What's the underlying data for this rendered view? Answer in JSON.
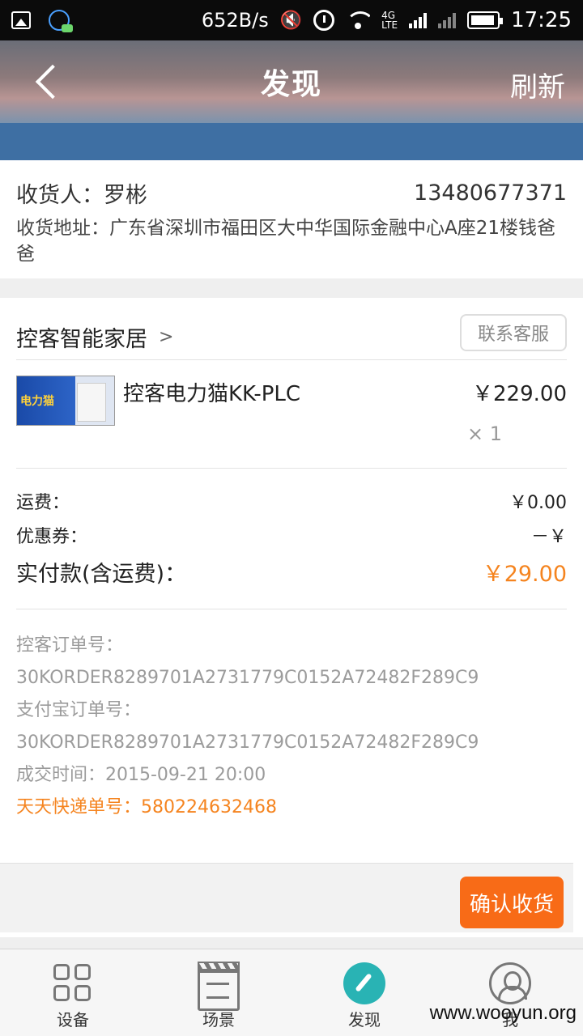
{
  "status_bar": {
    "net_speed": "652B/s",
    "time": "17:25",
    "network_type": "4G",
    "lte": "LTE",
    "sim1": "1",
    "sim2": "2"
  },
  "header": {
    "title": "发现",
    "refresh_label": "刷新"
  },
  "address": {
    "recipient_label": "收货人：罗彬",
    "phone": "13480677371",
    "address_line": "收货地址：广东省深圳市福田区大中华国际金融中心A座21楼钱爸爸"
  },
  "store": {
    "name": "控客智能家居",
    "chevron": ">",
    "contact_label": "联系客服"
  },
  "product": {
    "thumb_text": "电力猫",
    "name": "控客电力猫KK-PLC",
    "price": "￥229.00",
    "quantity": "× 1"
  },
  "fees": {
    "shipping_label": "运费：",
    "shipping_value": "￥0.00",
    "coupon_label": "优惠券：",
    "coupon_value": "－￥",
    "total_label": "实付款(含运费)：",
    "total_value": "￥29.00"
  },
  "order_info": {
    "order_no_label": "控客订单号：",
    "order_no": "30KORDER8289701A2731779C0152A72482F289C9",
    "alipay_label": "支付宝订单号：",
    "alipay_no": "30KORDER8289701A2731779C0152A72482F289C9",
    "deal_time": "成交时间：2015-09-21 20:00",
    "tracking": "天天快递单号：580224632468"
  },
  "action": {
    "confirm_label": "确认收货"
  },
  "tabbar": {
    "tabs": [
      {
        "label": "设备",
        "icon": "grid-icon"
      },
      {
        "label": "场景",
        "icon": "clapperboard-icon"
      },
      {
        "label": "发现",
        "icon": "compass-icon"
      },
      {
        "label": "我",
        "icon": "profile-icon"
      }
    ]
  },
  "watermark": "www.wooyun.org",
  "colors": {
    "accent_orange": "#f86b17",
    "active_tab": "#29b3b4",
    "header_band": "#3e6fa3"
  }
}
